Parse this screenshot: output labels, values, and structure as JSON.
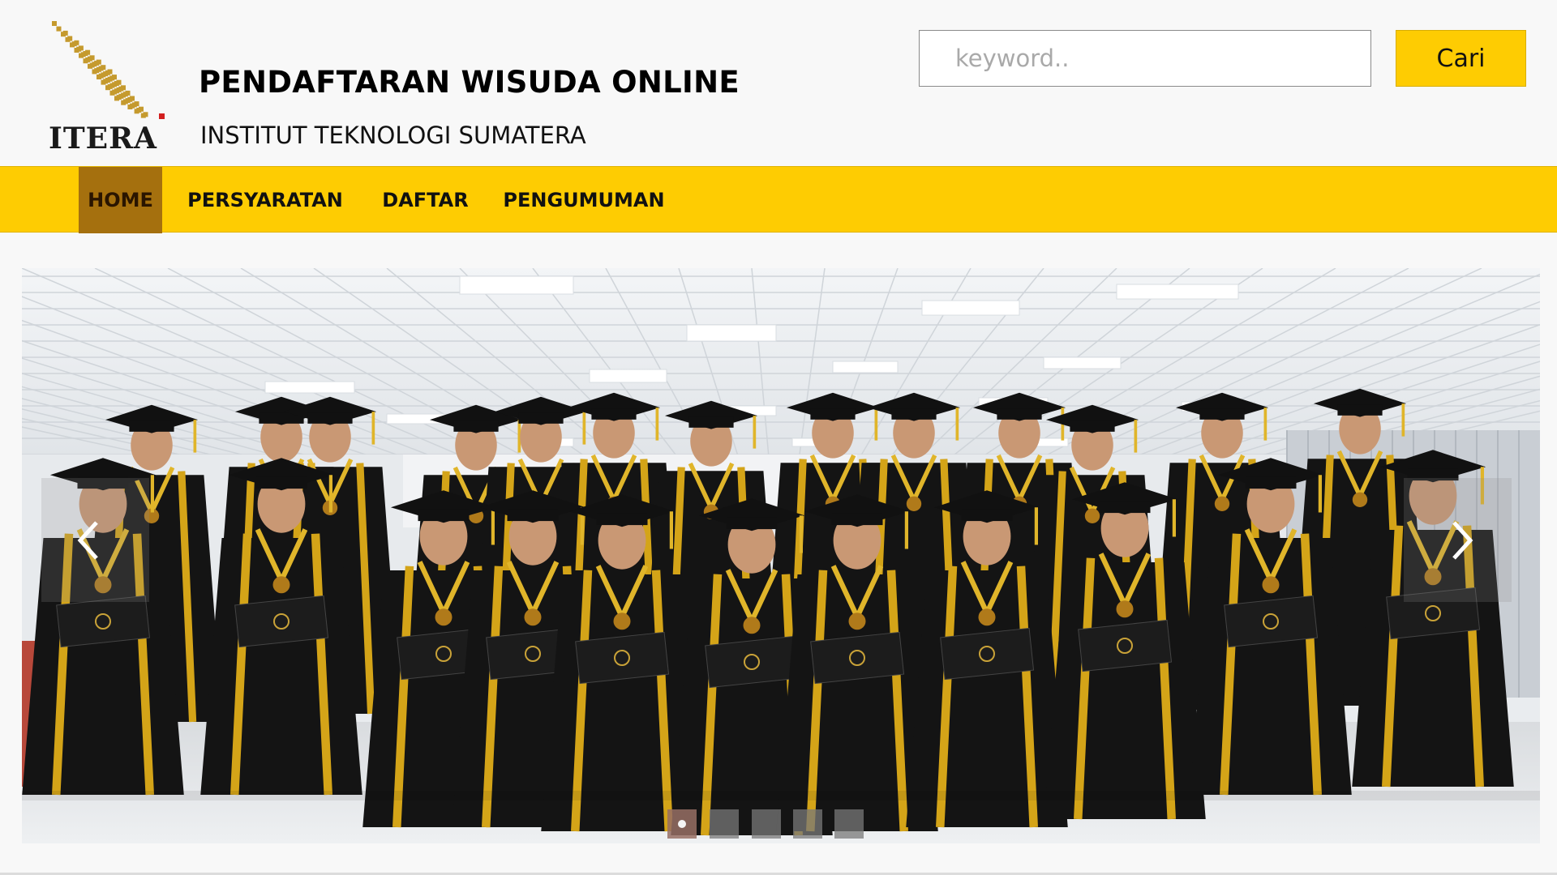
{
  "brand": {
    "logo_text": "ITERA",
    "title": "PENDAFTARAN WISUDA ONLINE",
    "subtitle": "INSTITUT TEKNOLOGI SUMATERA",
    "logo_icon": "sumatra-island-grid-icon"
  },
  "search": {
    "placeholder": "keyword..",
    "value": "",
    "button_label": "Cari"
  },
  "nav": {
    "items": [
      {
        "label": "HOME",
        "active": true
      },
      {
        "label": "PERSYARATAN",
        "active": false
      },
      {
        "label": "DAFTAR",
        "active": false
      },
      {
        "label": "PENGUMUMAN",
        "active": false
      }
    ]
  },
  "slider": {
    "image_description_icon": "graduation-group-photo",
    "prev_icon": "chevron-left-icon",
    "next_icon": "chevron-right-icon",
    "slide_count": 5,
    "active_slide": 1
  },
  "colors": {
    "accent": "#fecc02",
    "nav_active": "#a5700e",
    "logo_gold": "#c59a2e",
    "logo_red": "#d21f1f",
    "page_bg": "#f8f8f8"
  }
}
